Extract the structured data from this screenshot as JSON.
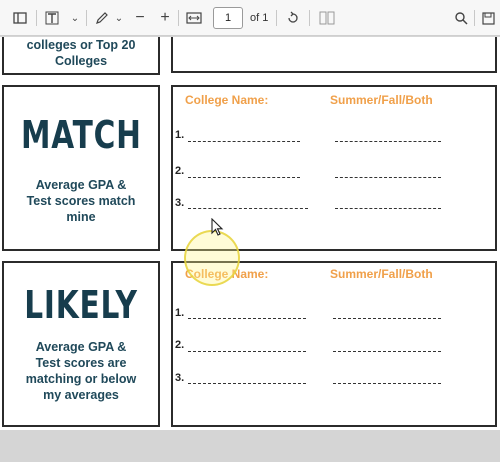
{
  "toolbar": {
    "page_number": "1",
    "page_count": "of 1",
    "zoom_out": "−",
    "zoom_in": "+"
  },
  "top_partial": {
    "category_desc": "colleges or Top 20\nColleges"
  },
  "sections": [
    {
      "category": "MATCH",
      "description": "Average GPA &\nTest scores match\nmine",
      "header_college": "College Name:",
      "header_term": "Summer/Fall/Both",
      "rows": [
        "1.",
        "2.",
        "3."
      ]
    },
    {
      "category": "LIKELY",
      "description": "Average GPA &\nTest scores are\nmatching or below\nmy averages",
      "header_college": "College Name:",
      "header_term": "Summer/Fall/Both",
      "rows": [
        "1.",
        "2.",
        "3."
      ]
    }
  ]
}
